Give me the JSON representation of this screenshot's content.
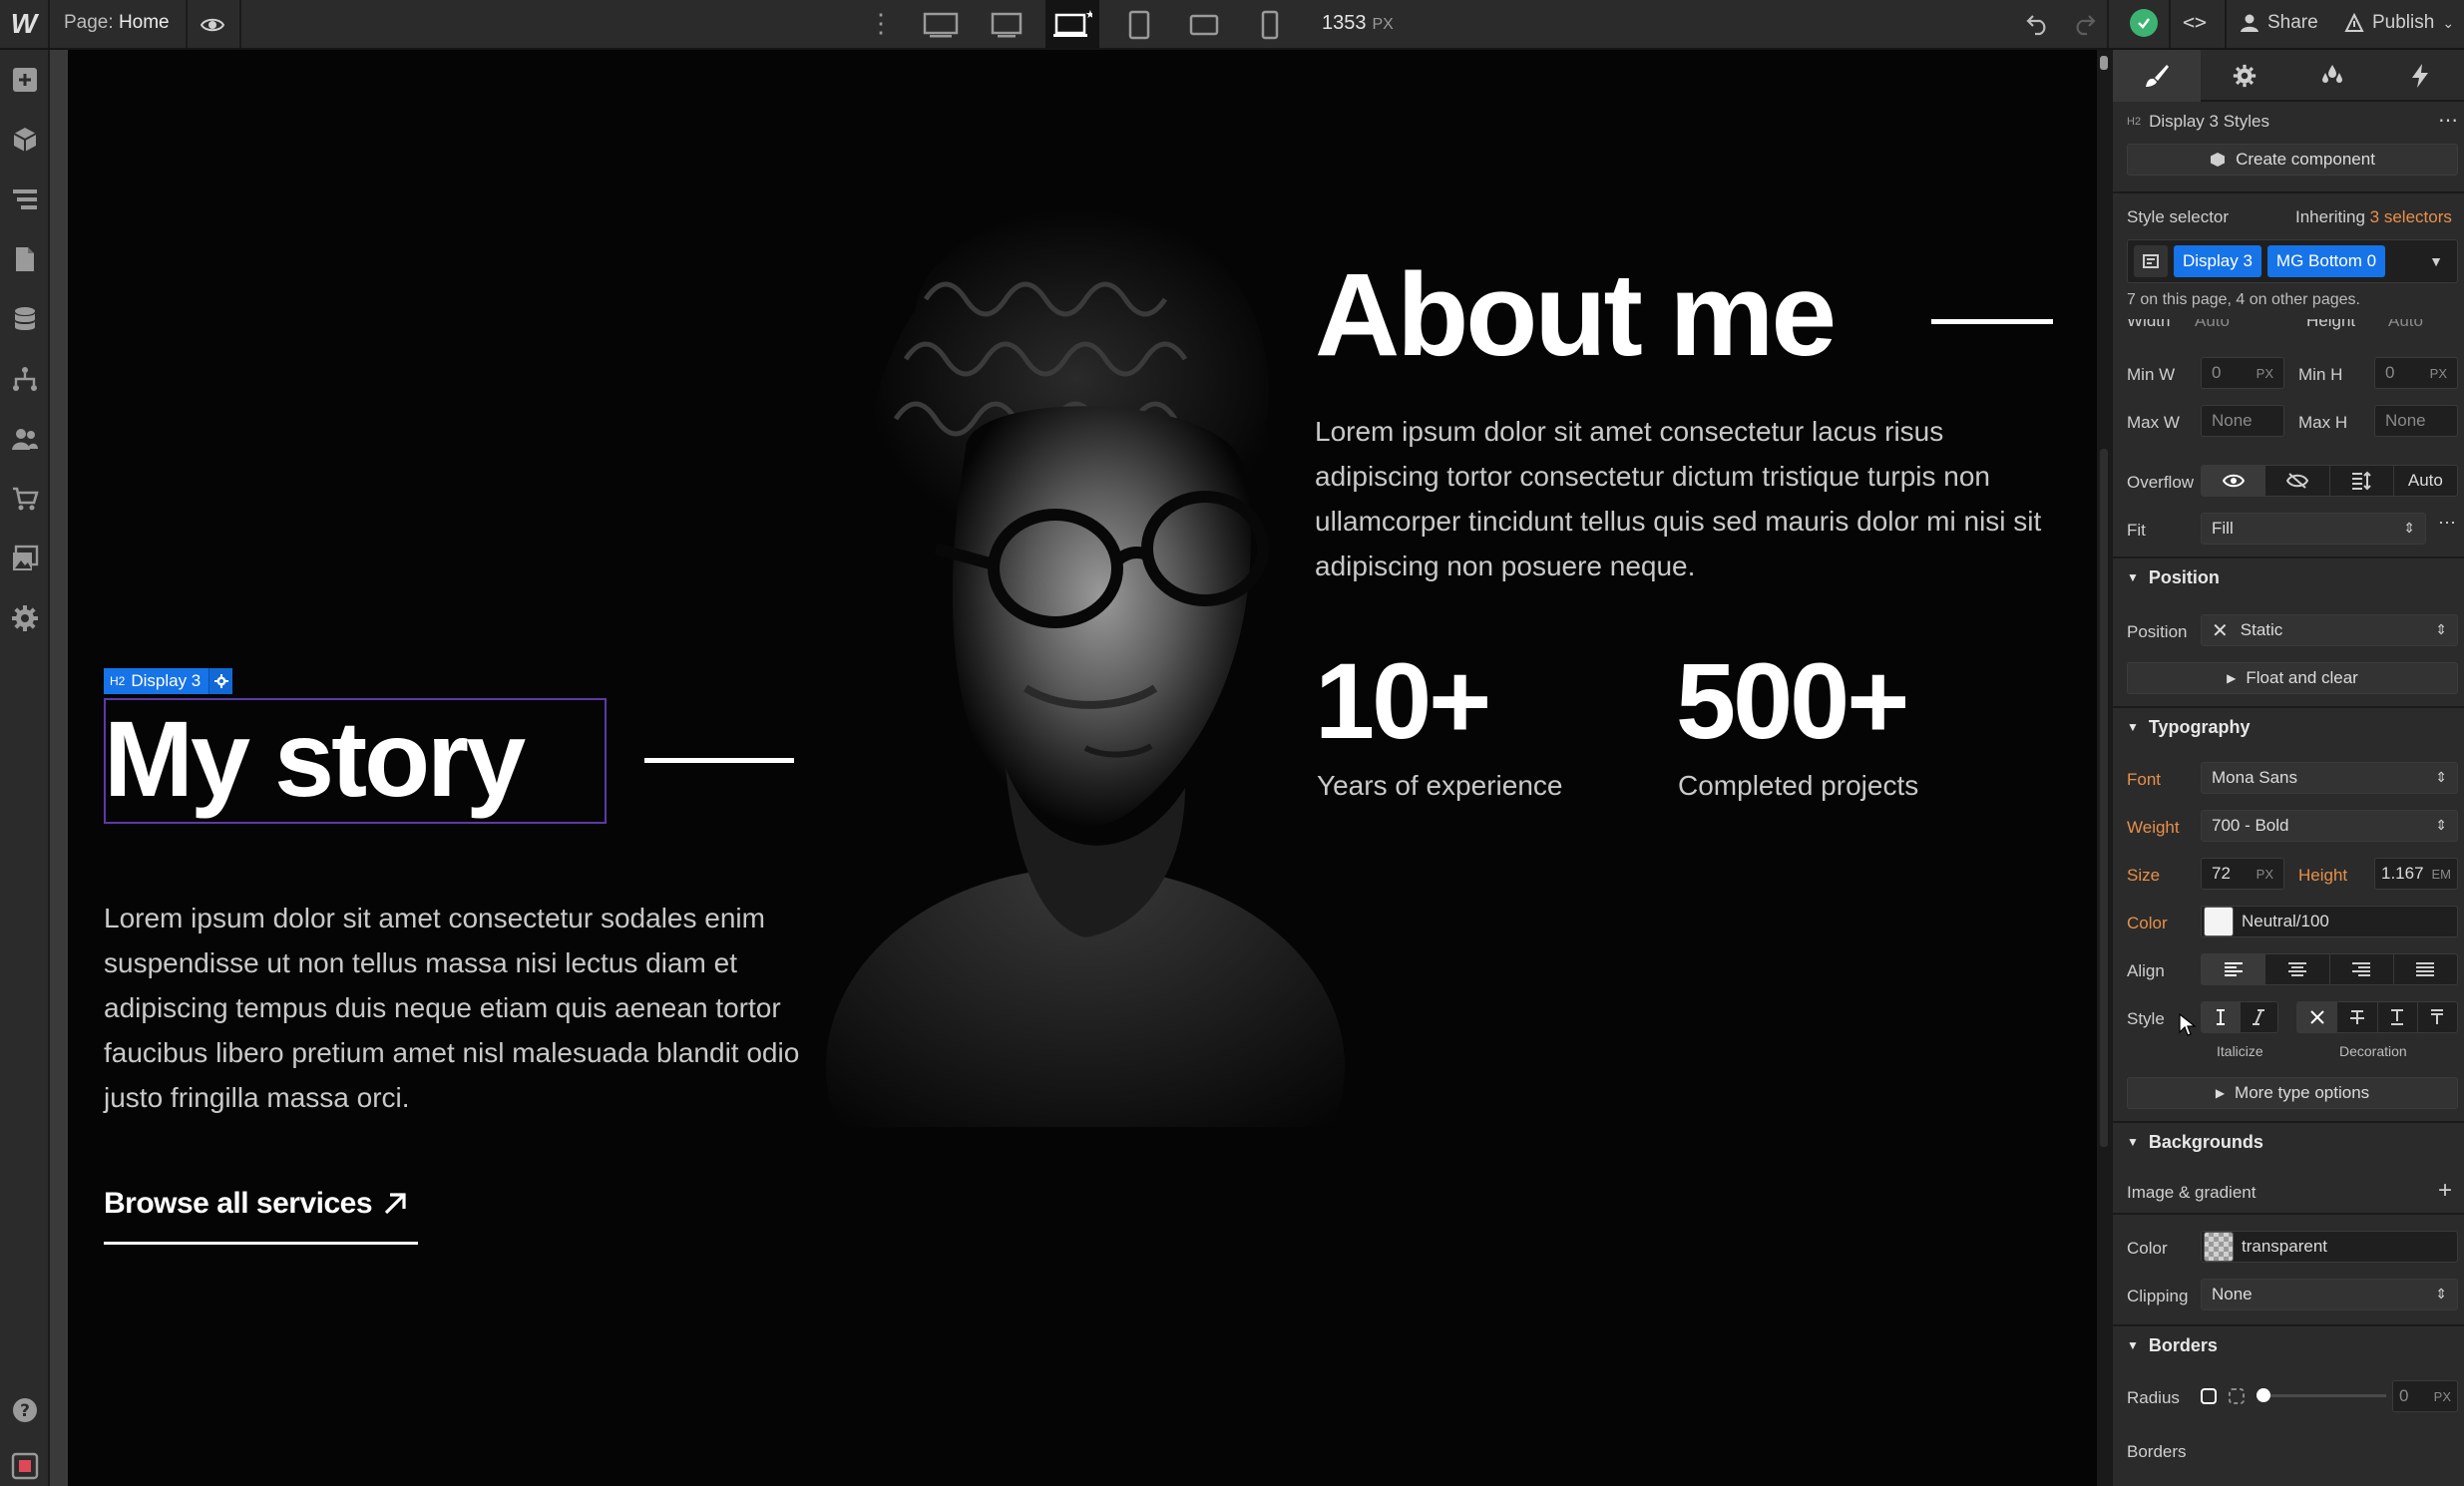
{
  "topbar": {
    "page_label": "Page:",
    "page_name": "Home",
    "viewport_width": "1353",
    "viewport_unit": "PX",
    "share_label": "Share",
    "publish_label": "Publish"
  },
  "canvas": {
    "about_title": "About me",
    "about_paragraph": "Lorem ipsum dolor sit amet consectetur lacus risus adipiscing tortor consectetur dictum tristique turpis non ullamcorper tincidunt tellus quis sed mauris dolor mi nisi sit adipiscing non posuere neque.",
    "stats": [
      {
        "value": "10+",
        "label": "Years of experience"
      },
      {
        "value": "500+",
        "label": "Completed projects"
      }
    ],
    "selection_tag_prefix": "H2",
    "selection_tag_label": "Display 3",
    "story_title": "My story",
    "story_paragraph": "Lorem ipsum dolor sit amet consectetur sodales enim suspendisse ut non tellus massa nisi lectus diam et adipiscing tempus duis neque etiam quis aenean tortor faucibus libero pretium amet nisl malesuada blandit odio justo fringilla massa orci.",
    "browse_label": "Browse all services"
  },
  "panel": {
    "element_prefix": "H2",
    "element_title": "Display 3 Styles",
    "create_component": "Create component",
    "style_selector_label": "Style selector",
    "inheriting_prefix": "Inheriting",
    "inheriting_count": "3 selectors",
    "selectors": [
      "Display 3",
      "MG Bottom 0"
    ],
    "usage_note": "7 on this page, 4 on other pages.",
    "size": {
      "width_label": "Width",
      "width_val": "Auto",
      "height_label": "Height",
      "height_val": "Auto",
      "minw_label": "Min W",
      "minw_val": "0",
      "minw_unit": "PX",
      "minh_label": "Min H",
      "minh_val": "0",
      "minh_unit": "PX",
      "maxw_label": "Max W",
      "maxw_val": "None",
      "maxh_label": "Max H",
      "maxh_val": "None",
      "overflow_label": "Overflow",
      "overflow_auto": "Auto",
      "fit_label": "Fit",
      "fit_val": "Fill"
    },
    "position": {
      "section": "Position",
      "label": "Position",
      "value": "Static",
      "float_clear": "Float and clear"
    },
    "typography": {
      "section": "Typography",
      "font_label": "Font",
      "font_val": "Mona Sans",
      "weight_label": "Weight",
      "weight_val": "700 - Bold",
      "size_label": "Size",
      "size_val": "72",
      "size_unit": "PX",
      "height_label": "Height",
      "height_val": "1.167",
      "height_unit": "EM",
      "color_label": "Color",
      "color_val": "Neutral/100",
      "align_label": "Align",
      "style_label": "Style",
      "italicize": "Italicize",
      "decoration": "Decoration",
      "more_type": "More type options"
    },
    "backgrounds": {
      "section": "Backgrounds",
      "image_gradient": "Image & gradient",
      "color_label": "Color",
      "color_val": "transparent",
      "clipping_label": "Clipping",
      "clipping_val": "None"
    },
    "borders": {
      "section": "Borders",
      "radius_label": "Radius",
      "radius_val": "0",
      "radius_unit": "PX",
      "borders_label": "Borders"
    }
  },
  "colors": {
    "accent": "#1673e8",
    "success": "#3cb371",
    "inherit_orange": "#e8904a",
    "selection_outline": "#5a3aa8"
  }
}
